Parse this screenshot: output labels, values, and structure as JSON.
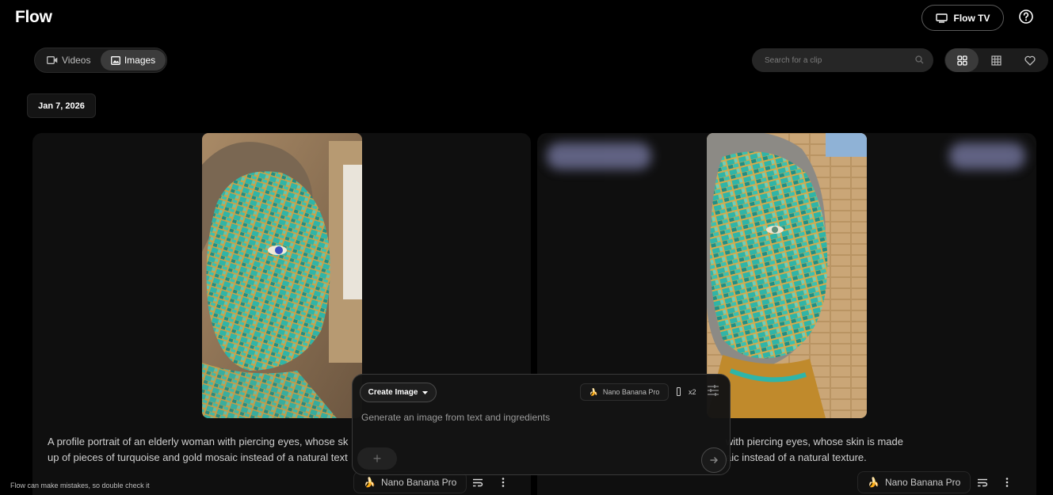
{
  "app": {
    "title": "Flow"
  },
  "header": {
    "flow_tv_label": "Flow TV"
  },
  "tabs": [
    {
      "label": "Videos",
      "selected": false
    },
    {
      "label": "Images",
      "selected": true
    }
  ],
  "search": {
    "placeholder": "Search for a clip"
  },
  "view_modes": {
    "selected": "grid",
    "options": [
      "grid-icon",
      "table-icon",
      "heart-icon"
    ]
  },
  "date_group": {
    "label": "Jan 7, 2026"
  },
  "cards": [
    {
      "model_label": "Nano Banana Pro",
      "description_line1": "A profile portrait of an elderly woman with piercing eyes, whose sk",
      "description_line2": "up of pieces of turquoise and gold mosaic instead of a natural text"
    },
    {
      "model_label": "Nano Banana Pro",
      "description_line1": "with piercing eyes, whose skin is made",
      "description_line2": "aic instead of a natural texture."
    }
  ],
  "composer": {
    "mode_label": "Create Image",
    "model_label": "Nano Banana Pro",
    "count_label": "x2",
    "prompt_placeholder": "Generate an image from text and ingredients"
  },
  "footer": {
    "disclaimer": "Flow can make mistakes, so double check it"
  },
  "colors": {
    "background": "#000000",
    "card": "#0f0f0f",
    "turquoise": "#2fb5a8",
    "gold": "#c9a24a"
  }
}
